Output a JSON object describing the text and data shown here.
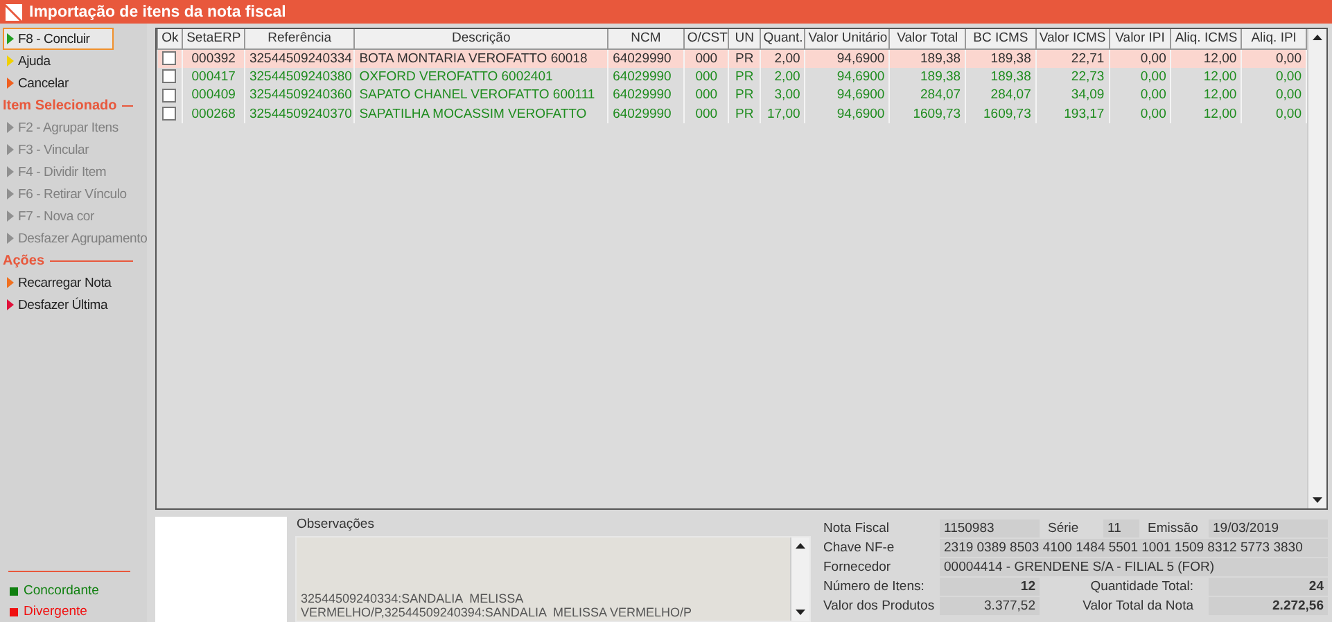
{
  "window": {
    "title": "Importação de itens da nota fiscal"
  },
  "sidebar": {
    "groups": [
      {
        "items": [
          {
            "label": "F8 - Concluir",
            "color": "#22a022",
            "disabled": false,
            "focused": true
          },
          {
            "label": "Ajuda",
            "color": "#f0d000",
            "disabled": false,
            "focused": false
          },
          {
            "label": "Cancelar",
            "color": "#f06020",
            "disabled": false,
            "focused": false
          }
        ]
      },
      {
        "title": "Item Selecionado",
        "items": [
          {
            "label": "F2 - Agrupar Itens",
            "color": "#909090",
            "disabled": true,
            "focused": false
          },
          {
            "label": "F3 - Vincular",
            "color": "#909090",
            "disabled": true,
            "focused": false
          },
          {
            "label": "F4 - Dividir Item",
            "color": "#909090",
            "disabled": true,
            "focused": false
          },
          {
            "label": "F6 - Retirar Vínculo",
            "color": "#909090",
            "disabled": true,
            "focused": false
          },
          {
            "label": "F7 - Nova cor",
            "color": "#909090",
            "disabled": true,
            "focused": false
          },
          {
            "label": "Desfazer Agrupamento",
            "color": "#909090",
            "disabled": true,
            "focused": false
          }
        ]
      },
      {
        "title": "Ações",
        "items": [
          {
            "label": "Recarregar Nota",
            "color": "#f07020",
            "disabled": false,
            "focused": false
          },
          {
            "label": "Desfazer Última",
            "color": "#e0103a",
            "disabled": false,
            "focused": false
          }
        ]
      }
    ],
    "legend": [
      {
        "label": "Concordante",
        "color": "#108010"
      },
      {
        "label": "Divergente",
        "color": "#f01010"
      }
    ]
  },
  "table": {
    "checkbox_column": "Ok",
    "columns": [
      "SetaERP",
      "Referência",
      "Descrição",
      "NCM",
      "O/CST",
      "UN",
      "Quant.",
      "Valor Unitário",
      "Valor Total",
      "BC ICMS",
      "Valor ICMS",
      "Valor IPI",
      "Aliq. ICMS",
      "Aliq. IPI"
    ],
    "rows": [
      {
        "selected": true,
        "checked": false,
        "color": "#303030",
        "cells": [
          "000392",
          "32544509240334",
          "BOTA MONTARIA VEROFATTO 60018",
          "64029990",
          "000",
          "PR",
          "2,00",
          "94,6900",
          "189,38",
          "189,38",
          "22,71",
          "0,00",
          "12,00",
          "0,00"
        ]
      },
      {
        "selected": false,
        "checked": false,
        "color": "#1e8c1e",
        "cells": [
          "000417",
          "32544509240380",
          "OXFORD VEROFATTO 6002401",
          "64029990",
          "000",
          "PR",
          "2,00",
          "94,6900",
          "189,38",
          "189,38",
          "22,73",
          "0,00",
          "12,00",
          "0,00"
        ]
      },
      {
        "selected": false,
        "checked": false,
        "color": "#1e8c1e",
        "cells": [
          "000409",
          "32544509240360",
          "SAPATO CHANEL VEROFATTO 600111",
          "64029990",
          "000",
          "PR",
          "3,00",
          "94,6900",
          "284,07",
          "284,07",
          "34,09",
          "0,00",
          "12,00",
          "0,00"
        ]
      },
      {
        "selected": false,
        "checked": false,
        "color": "#1e8c1e",
        "cells": [
          "000268",
          "32544509240370",
          "SAPATILHA MOCASSIM VEROFATTO",
          "64029990",
          "000",
          "PR",
          "17,00",
          "94,6900",
          "1609,73",
          "1609,73",
          "193,17",
          "0,00",
          "12,00",
          "0,00"
        ]
      }
    ]
  },
  "observations": {
    "label": "Observações",
    "text": "32544509240334:SANDALIA  MELISSA        VERMELHO/P,32544509240394:SANDALIA  MELISSA VERMELHO/P"
  },
  "invoice": {
    "nota_fiscal_label": "Nota Fiscal",
    "nota_fiscal": "1150983",
    "serie_label": "Série",
    "serie": "11",
    "emissao_label": "Emissão",
    "emissao": "19/03/2019",
    "chave_label": "Chave NF-e",
    "chave": "2319 0389 8503 4100 1484 5501 1001 1509 8312 5773 3830",
    "fornecedor_label": "Fornecedor",
    "fornecedor": "00004414 - GRENDENE S/A - FILIAL 5 (FOR)",
    "num_itens_label": "Número de Itens:",
    "num_itens": "12",
    "qtd_total_label": "Quantidade Total:",
    "qtd_total": "24",
    "valor_produtos_label": "Valor dos Produtos",
    "valor_produtos": "3.377,52",
    "valor_total_label": "Valor Total da Nota",
    "valor_total": "2.272,56"
  }
}
